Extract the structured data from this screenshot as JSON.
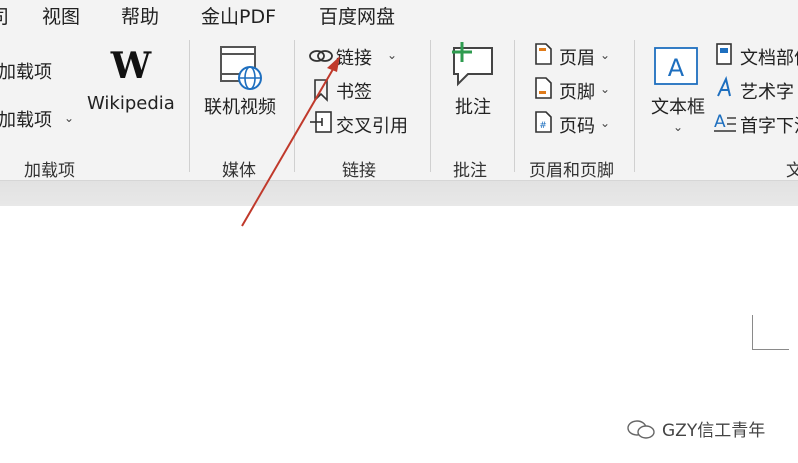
{
  "menu": {
    "items": [
      "司",
      "视图",
      "帮助",
      "金山PDF",
      "百度网盘"
    ]
  },
  "addins": {
    "item1": "加载项",
    "item2": "加载项",
    "wikipedia": "Wikipedia",
    "group": "加载项"
  },
  "media": {
    "online_video": "联机视频",
    "group": "媒体"
  },
  "links": {
    "link": "链接",
    "bookmark": "书签",
    "cross_ref": "交叉引用",
    "group": "链接"
  },
  "comments": {
    "comment": "批注",
    "group": "批注"
  },
  "header_footer": {
    "header": "页眉",
    "footer": "页脚",
    "page_number": "页码",
    "group": "页眉和页脚"
  },
  "text": {
    "text_box": "文本框",
    "quick_parts": "文档部件",
    "wordart": "艺术字",
    "drop_cap": "首字下沉",
    "group_partial": "文"
  },
  "watermark": "GZY信工青年",
  "colors": {
    "ribbon_bg": "#f3f3f3",
    "icon_blue": "#1e6fbf",
    "icon_green": "#2e9b4f",
    "annotation_arrow": "#c0392b"
  }
}
